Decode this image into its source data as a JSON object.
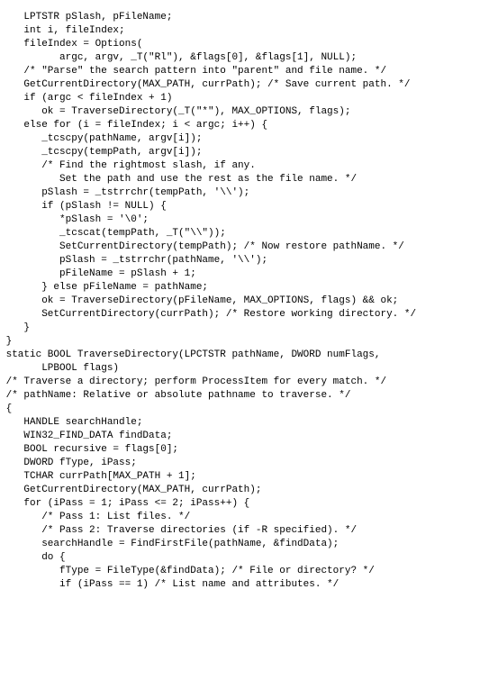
{
  "code": {
    "lines": [
      "    LPTSTR pSlash, pFileName;",
      "    int i, fileIndex;",
      "",
      "    fileIndex = Options(",
      "          argc, argv, _T(\"Rl\"), &flags[0], &flags[1], NULL);",
      "",
      "    /* \"Parse\" the search pattern into \"parent\" and file name. */",
      "    GetCurrentDirectory(MAX_PATH, currPath); /* Save current path. */",
      "    if (argc < fileIndex + 1)",
      "       ok = TraverseDirectory(_T(\"*\"), MAX_OPTIONS, flags);",
      "    else for (i = fileIndex; i < argc; i++) {",
      "       _tcscpy(pathName, argv[i]);",
      "       _tcscpy(tempPath, argv[i]);",
      "",
      "       /* Find the rightmost slash, if any.",
      "          Set the path and use the rest as the file name. */",
      "       pSlash = _tstrrchr(tempPath, '\\\\');",
      "       if (pSlash != NULL) {",
      "          *pSlash = '\\0';",
      "          _tcscat(tempPath, _T(\"\\\\\"));",
      "          SetCurrentDirectory(tempPath); /* Now restore pathName. */",
      "          pSlash = _tstrrchr(pathName, '\\\\');",
      "          pFileName = pSlash + 1;",
      "       } else pFileName = pathName;",
      "       ok = TraverseDirectory(pFileName, MAX_OPTIONS, flags) && ok;",
      "       SetCurrentDirectory(currPath); /* Restore working directory. */",
      "    }",
      " }",
      "",
      " static BOOL TraverseDirectory(LPCTSTR pathName, DWORD numFlags,",
      "       LPBOOL flags)",
      "",
      " /* Traverse a directory; perform ProcessItem for every match. */",
      " /* pathName: Relative or absolute pathname to traverse. */",
      " {",
      "    HANDLE searchHandle;",
      "    WIN32_FIND_DATA findData;",
      "    BOOL recursive = flags[0];",
      "    DWORD fType, iPass;",
      "    TCHAR currPath[MAX_PATH + 1];",
      "",
      "    GetCurrentDirectory(MAX_PATH, currPath);",
      "",
      "    for (iPass = 1; iPass <= 2; iPass++) {",
      "       /* Pass 1: List files. */",
      "       /* Pass 2: Traverse directories (if -R specified). */",
      "       searchHandle = FindFirstFile(pathName, &findData);",
      "       do {",
      "          fType = FileType(&findData); /* File or directory? */",
      "          if (iPass == 1) /* List name and attributes. */"
    ]
  }
}
